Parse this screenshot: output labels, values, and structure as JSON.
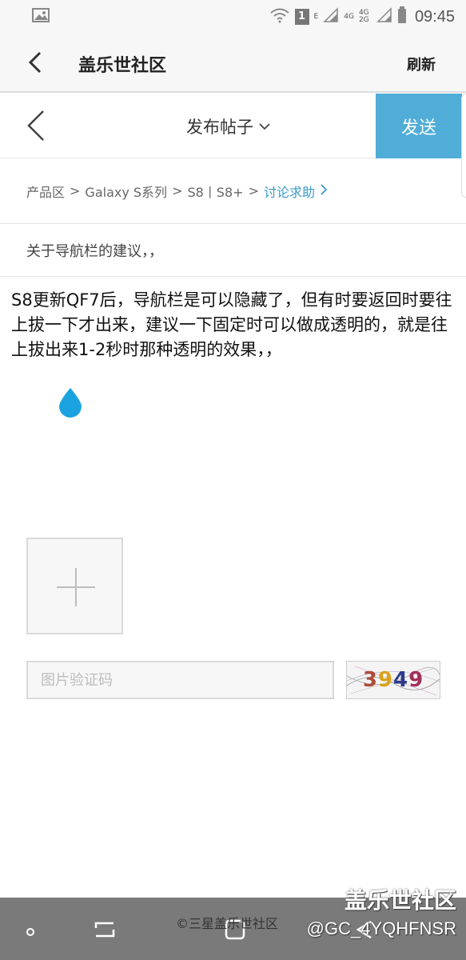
{
  "status_bar": {
    "time": "09:45",
    "notification_count": "1",
    "network_e": "E",
    "network_4g": "4G",
    "network_4g_2g": "4G 2G"
  },
  "app_header": {
    "title": "盖乐世社区",
    "refresh_label": "刷新"
  },
  "post_bar": {
    "title": "发布帖子",
    "send_label": "发送",
    "accent_color": "#4fadd8"
  },
  "breadcrumb": {
    "items": [
      "产品区",
      "Galaxy S系列",
      "S8丨S8+",
      "讨论求助"
    ],
    "separator": ">",
    "active_color": "#3a9bc9"
  },
  "post": {
    "subject": "关于导航栏的建议，，",
    "body": "S8更新QF7后，导航栏是可以隐藏了，但有时要返回时要往上拔一下才出来，建议一下固定时可以做成透明的，就是往上拔出来1-2秒时那种透明的效果，，"
  },
  "captcha": {
    "placeholder": "图片验证码",
    "code": "3949",
    "colors": [
      "#b04a3a",
      "#d9a21b",
      "#2e3a8c",
      "#a32f5a"
    ]
  },
  "watermark": {
    "title": "盖乐世社区",
    "user": "@GC_4YQHFNSR",
    "copyright": "©三星盖乐世社区"
  }
}
